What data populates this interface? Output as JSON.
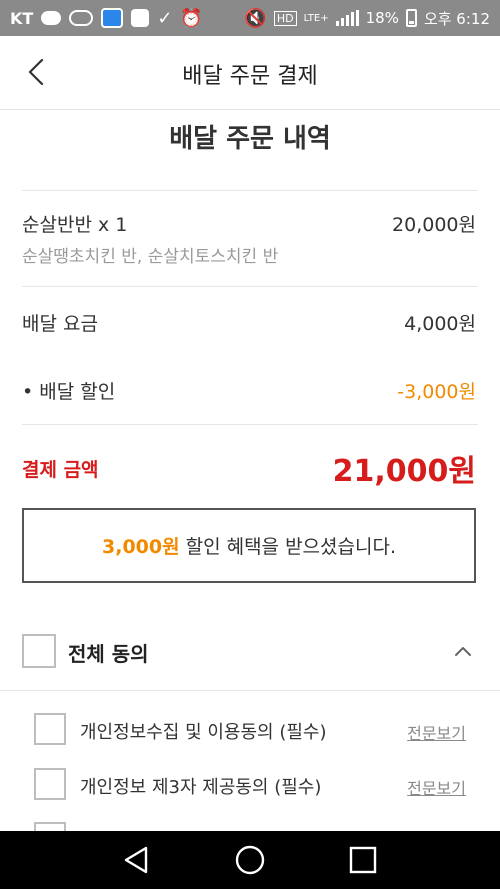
{
  "status_bar": {
    "carrier": "KT",
    "battery": "18%",
    "time": "오후 6:12",
    "network": "LTE+"
  },
  "header": {
    "title": "배달 주문 결제",
    "back_icon": "back-arrow-icon"
  },
  "order": {
    "section_title": "배달 주문 내역",
    "item_name": "순살반반 x 1",
    "item_price": "20,000원",
    "item_options": "순살땡초치킨 반, 순살치토스치킨 반",
    "delivery_fee_label": "배달 요금",
    "delivery_fee": "4,000원",
    "delivery_discount_label": "• 배달 할인",
    "delivery_discount": "-3,000원",
    "total_label": "결제 금액",
    "total": "21,000원"
  },
  "discount_notice": {
    "amount": "3,000원",
    "text": "할인 혜택을 받으셨습니다."
  },
  "agreements": {
    "all_label": "전체 동의",
    "items": [
      {
        "label": "개인정보수집 및 이용동의 (필수)",
        "link": "전문보기"
      },
      {
        "label": "개인정보 제3자 제공동의 (필수)",
        "link": "전문보기"
      }
    ]
  },
  "colors": {
    "accent_red": "#d71c1c",
    "accent_orange": "#f28a00",
    "status_bar": "#8a8a8a",
    "nav_bar": "#000000"
  }
}
